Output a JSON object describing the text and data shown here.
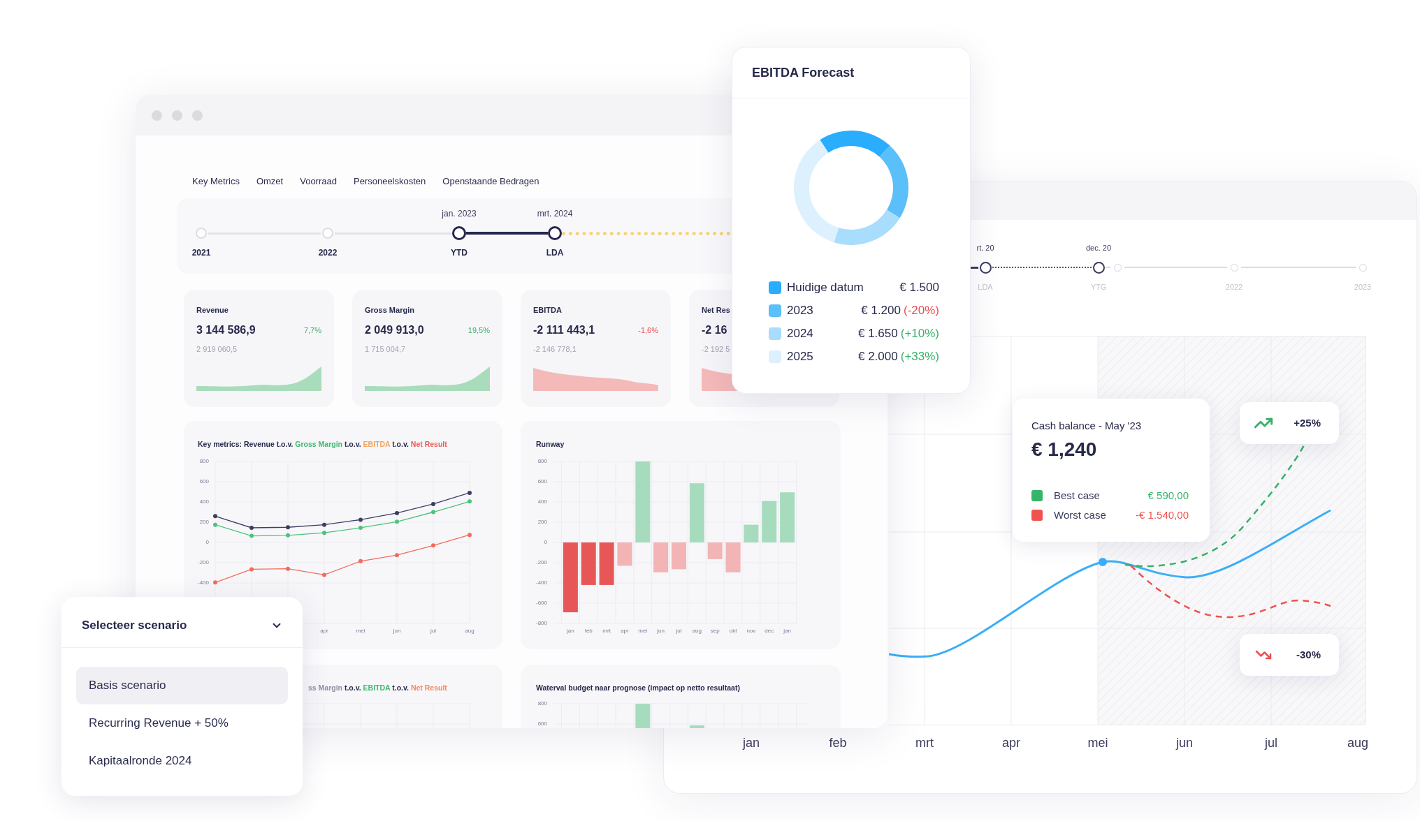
{
  "main_window": {
    "tabs": [
      {
        "label": "Key Metrics"
      },
      {
        "label": "Omzet"
      },
      {
        "label": "Voorraad"
      },
      {
        "label": "Personeelskosten"
      },
      {
        "label": "Openstaande Bedragen"
      }
    ],
    "timeline": {
      "points": [
        {
          "label": "2021",
          "kind": "milestone"
        },
        {
          "label": "2022",
          "kind": "milestone"
        },
        {
          "date": "jan. 2023",
          "label": "YTD",
          "kind": "marker"
        },
        {
          "date": "mrt. 2024",
          "label": "LDA",
          "kind": "marker"
        }
      ],
      "lines": [
        {
          "kind": "plain"
        },
        {
          "kind": "plain"
        },
        {
          "kind": "bold"
        },
        {
          "kind": "highlight"
        }
      ]
    },
    "metric_cards": [
      {
        "title": "Revenue",
        "value": "3 144 586,9",
        "change": "7,7%",
        "previous": "2 919 060,5",
        "kind": "up"
      },
      {
        "title": "Gross Margin",
        "value": "2 049 913,0",
        "change": "19,5%",
        "previous": "1 715 004,7",
        "kind": "up"
      },
      {
        "title": "EBITDA",
        "value": "-2 111 443,1",
        "change": "-1,6%",
        "previous": "-2 146 778,1",
        "kind": "down"
      },
      {
        "title": "Net Res",
        "value": "-2 16",
        "previous": "-2 192 5",
        "kind": "down"
      }
    ],
    "key_metrics_chart": {
      "title_parts": [
        {
          "text": "Key metrics: Revenue t.o.v.",
          "color": "#27294a"
        },
        {
          "text": "Gross Margin",
          "color": "#3fb86f"
        },
        {
          "text": "t.o.v.",
          "color": "#27294a"
        },
        {
          "text": "EBITDA",
          "color": "#f5a25d"
        },
        {
          "text": "t.o.v.",
          "color": "#27294a"
        },
        {
          "text": "Net Result",
          "color": "#f0584f"
        }
      ],
      "chart_data": [
        {
          "type": "line",
          "categories": [
            null,
            null,
            null,
            "apr",
            "mei",
            "jun",
            "jul",
            "aug"
          ],
          "series": [
            {
              "color": "#3d3e63",
              "values": [
                260,
                145,
                150,
                175,
                225,
                290,
                380,
                490
              ]
            },
            {
              "color": "#4cc37c",
              "values": [
                175,
                65,
                70,
                95,
                145,
                205,
                300,
                405
              ]
            },
            {
              "color": "#f26b5b",
              "values": [
                -395,
                -265,
                -260,
                -320,
                -185,
                -125,
                -30,
                75
              ]
            }
          ],
          "yticks": [
            -400,
            -200,
            0,
            200,
            400,
            600,
            800
          ],
          "ylim": [
            -800,
            800
          ],
          "grid": true,
          "marker": "circle"
        }
      ]
    },
    "runway_chart": {
      "title": "Runway",
      "chart_data": [
        {
          "type": "bar",
          "categories": [
            "jan",
            "feb",
            "mrt",
            "apr",
            "mei",
            "jun",
            "jul",
            "aug",
            "sep",
            "okt",
            "nov",
            "dec",
            "jan"
          ],
          "values": [
            -690,
            -420,
            -420,
            -230,
            800,
            -295,
            -265,
            585,
            -165,
            -295,
            175,
            410,
            495
          ],
          "colors": [
            "#e85757",
            "#e85757",
            "#e85757",
            "#f2b4b4",
            "#a6dcbd",
            "#f2b4b4",
            "#f2b4b4",
            "#a6dcbd",
            "#f2b4b4",
            "#f2b4b4",
            "#a6dcbd",
            "#a6dcbd",
            "#a6dcbd"
          ],
          "yticks": [
            -800,
            -600,
            -400,
            -200,
            0,
            200,
            400,
            600,
            800
          ],
          "ylim": [
            -800,
            800
          ],
          "grid": true
        }
      ]
    },
    "chart_3": {
      "title_parts": [
        {
          "text": "ss Margin",
          "color": "#8e8fa6"
        },
        {
          "text": "t.o.v.",
          "color": "#27294a"
        },
        {
          "text": "EBITDA",
          "color": "#3fb86f"
        },
        {
          "text": "t.o.v.",
          "color": "#27294a"
        },
        {
          "text": "Net Result",
          "color": "#f5865c"
        }
      ]
    },
    "waterfall_chart": {
      "title": "Waterval budget naar prognose (impact op netto resultaat)",
      "y_labels": [
        "800",
        "600"
      ]
    }
  },
  "ebitda_forecast": {
    "title": "EBITDA Forecast",
    "chart_data": [
      {
        "type": "donut",
        "categories": [
          "Huidige datum",
          "2023",
          "2024",
          "2025"
        ],
        "values": [
          21,
          22,
          21,
          36
        ],
        "colors": [
          "#29adfc",
          "#5bbff9",
          "#a9ddfd",
          "#dcf0fd"
        ],
        "legend": "bottom"
      }
    ],
    "legend_rows": [
      {
        "amount": "€ 1.500"
      },
      {
        "amount": "€ 1.200",
        "change": "(-20%)",
        "kind": "down"
      },
      {
        "amount": "€ 1.650",
        "change": "(+10%)",
        "kind": "up"
      },
      {
        "amount": "€ 2.000",
        "change": "(+33%)",
        "kind": "up"
      }
    ]
  },
  "forecast_window": {
    "timeline": {
      "points": [
        {
          "date": "rt. 20",
          "label": "LDA",
          "kind": "marker"
        },
        {
          "date": "dec. 20",
          "label": "YTG",
          "kind": "marker"
        },
        {
          "kind": "milestone"
        },
        {
          "label": "2022",
          "kind": "milestone"
        },
        {
          "label": "2023",
          "kind": "milestone"
        }
      ],
      "lines": [
        {
          "kind": "bold"
        },
        {
          "kind": "dotted"
        },
        {
          "kind": "plain"
        },
        {
          "kind": "plain"
        },
        {
          "kind": "plain"
        }
      ]
    },
    "months": [
      "jan",
      "feb",
      "mrt",
      "apr",
      "mei",
      "jun",
      "jul",
      "aug"
    ],
    "tooltip": {
      "title": "Cash balance - May '23",
      "value": "€ 1,240",
      "rows": [
        {
          "label": "Best case",
          "amount": "€ 590,00",
          "color": "#35b46a"
        },
        {
          "label": "Worst case",
          "amount": "-€ 1.540,00",
          "color": "#ef5350"
        }
      ]
    },
    "badges": [
      {
        "kind": "up",
        "text": "+25%"
      },
      {
        "kind": "down",
        "text": "-30%"
      }
    ]
  },
  "scenario_menu": {
    "title": "Selecteer scenario",
    "expanded": true,
    "options": [
      {
        "label": "Basis scenario",
        "selected": true
      },
      {
        "label": "Recurring Revenue + 50%",
        "selected": false
      },
      {
        "label": "Kapitaalronde 2024",
        "selected": false
      }
    ]
  }
}
